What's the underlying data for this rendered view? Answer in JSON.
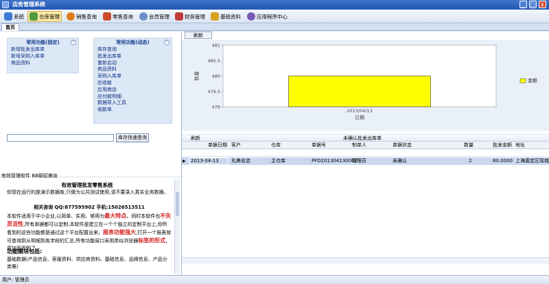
{
  "window": {
    "title": "店务管理系统",
    "minimize": "_",
    "maximize": "□",
    "close": "x"
  },
  "toolbar": {
    "items": [
      {
        "label": "系统",
        "color": "#3a7bd5"
      },
      {
        "label": "仓库管理",
        "color": "#4e9a3e"
      },
      {
        "label": "销售查询",
        "color": "#e07b1a"
      },
      {
        "label": "零售查询",
        "color": "#c94a2c"
      },
      {
        "label": "会员管理",
        "color": "#6a8fc9"
      },
      {
        "label": "财务管理",
        "color": "#c23a3a"
      },
      {
        "label": "基础资料",
        "color": "#d8a21f"
      },
      {
        "label": "应用程序中心",
        "color": "#7a59b8"
      }
    ]
  },
  "tabs": {
    "home": "首页"
  },
  "fixed_functions": {
    "header": "常用功能(固定)",
    "items": [
      "新增批发出库单",
      "新增采购入库单",
      "商品资料"
    ]
  },
  "dynamic_functions": {
    "header": "常用功能(动态)",
    "items": [
      "库存查询",
      "批发出库单",
      "重新启动",
      "商品资料",
      "采购入库单",
      "应收款",
      "应用商店",
      "应付款明细",
      "数据导入工具",
      "收款单"
    ]
  },
  "quick_search": {
    "button": "库存快速查询"
  },
  "chart_panel": {
    "refresh": "刷新"
  },
  "chart_data": {
    "type": "bar",
    "categories": [
      "2013/04/13"
    ],
    "series": [
      {
        "name": "金额",
        "values": [
          480
        ]
      }
    ],
    "xlabel": "日期",
    "ylabel": "数量",
    "ylim": [
      479,
      481
    ],
    "yticks": [
      "481",
      "480.5",
      "480",
      "479.5",
      "479"
    ],
    "bar_color": "#ffff00",
    "legend_position": "right",
    "grid": false
  },
  "grid": {
    "refresh": "刷新",
    "title": "未确认批发出库单",
    "columns": [
      "单据日期",
      "客户",
      "仓库",
      "单据号",
      "制单人",
      "单据状态",
      "数量",
      "批发金额",
      "地址"
    ],
    "rows": [
      [
        "2013-04-13",
        "丸美名店",
        "主仓库",
        "PFD201304130002",
        "管理员",
        "未确认",
        "2",
        "80.0000",
        "上海嘉定区瑶城"
      ]
    ],
    "row_marker": "▶"
  },
  "info": {
    "head": "有效管理软件 BB聊初美妆",
    "title": "有效管理批发零售系统",
    "p1": "你现在运行的是演示数据库,只做为公共测试使用,请不要录入真实业务数据。",
    "contact": "相关咨询 QQ:877595902 手机:15026513511",
    "p2a": "本软件适用于中小企业,以简单、实用、够用为",
    "p2b": "最大特点",
    "p2c": "。同时本软件也",
    "p2d": "不失灵活性",
    "p2e": ",所有单据都可以定制,本软件是建立在一个个独立的定制平台上,你所看到的这些功能都是通过这个平台配置出来。",
    "p2f": "报表功能强大",
    "p2g": ",打开一个报表就可查询到从明细到各字段的汇总,所有功能窗口采用类似浏览器",
    "p2h": "标签的形式",
    "p2i": ",更加直观明了。",
    "modules_title": "功能模块包括:",
    "modules_text": "基础数据(产品信息、客服资料、供应商资料、基础信息、品牌信息、产品分类等)"
  },
  "status": {
    "user": "用户: 管理员"
  }
}
